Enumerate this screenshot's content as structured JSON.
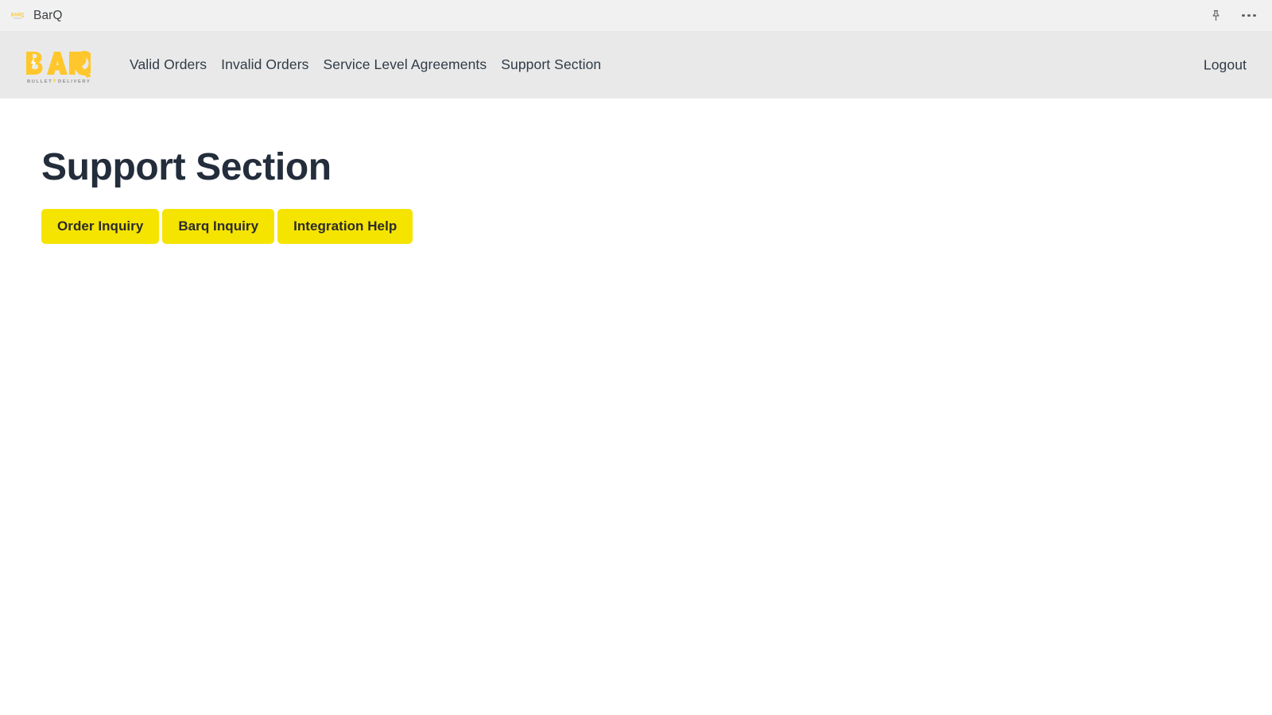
{
  "titlebar": {
    "title": "BarQ",
    "favicon_icon": "barq-favicon-icon",
    "pin_icon": "pushpin-icon",
    "more_icon": "more-options-ellipsis-icon"
  },
  "header": {
    "logo": {
      "name": "barq-logo",
      "wordmark": "BARQ",
      "tagline": "BULLET DELIVERY",
      "color": "#ffc72c",
      "tagline_color": "#8d8d8d"
    },
    "nav": [
      {
        "label": "Valid Orders",
        "key": "valid-orders"
      },
      {
        "label": "Invalid Orders",
        "key": "invalid-orders"
      },
      {
        "label": "Service Level Agreements",
        "key": "service-level-agreements"
      },
      {
        "label": "Support Section",
        "key": "support-section"
      }
    ],
    "logout_label": "Logout"
  },
  "main": {
    "page_title": "Support Section",
    "buttons": [
      {
        "label": "Order Inquiry",
        "key": "order-inquiry"
      },
      {
        "label": "Barq Inquiry",
        "key": "barq-inquiry"
      },
      {
        "label": "Integration Help",
        "key": "integration-help"
      }
    ]
  },
  "colors": {
    "accent_yellow": "#f5e400",
    "logo_yellow": "#ffc72c",
    "title_navy": "#232d3b",
    "header_bg": "#e9e9e9",
    "titlebar_bg": "#f1f1f1",
    "nav_text": "#2f3b47"
  }
}
